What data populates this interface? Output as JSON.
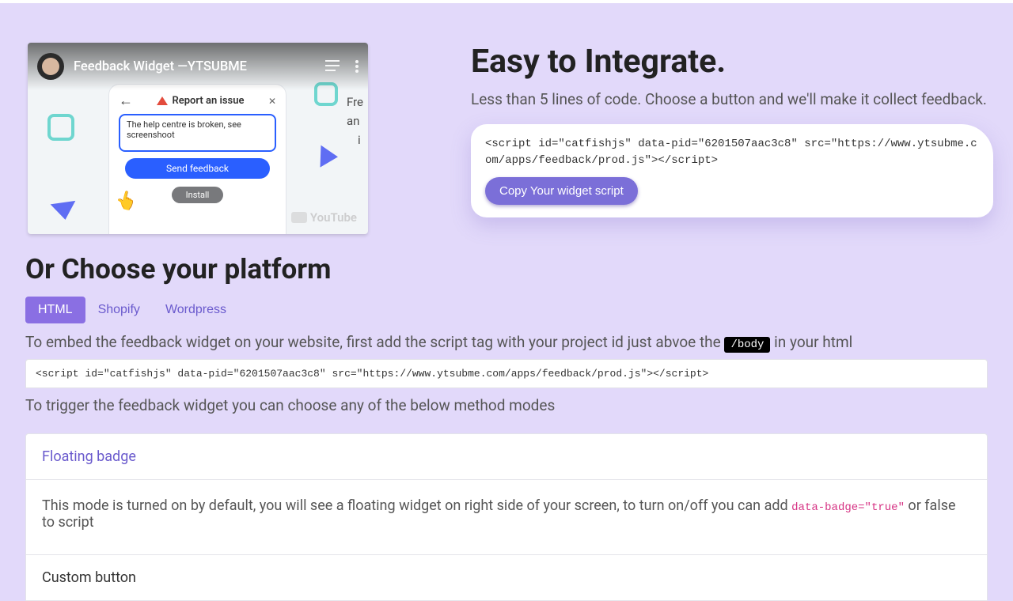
{
  "video": {
    "title": "Feedback Widget —YTSUBME",
    "mock_header": "Report an issue",
    "mock_input": "The help centre is broken, see screenshoot",
    "mock_send": "Send feedback",
    "mock_install": "Install",
    "youtube_label": "YouTube",
    "peek_lines": [
      "Fre",
      "an",
      "i"
    ]
  },
  "hero": {
    "heading": "Easy to Integrate.",
    "sub": "Less than 5 lines of code. Choose a button and we'll make it collect feedback.",
    "code": "<script id=\"catfishjs\" data-pid=\"6201507aac3c8\" src=\"https://www.ytsubme.com/apps/feedback/prod.js\"></script>",
    "copy_label": "Copy Your widget script"
  },
  "platform": {
    "heading": "Or Choose your platform",
    "tabs": [
      "HTML",
      "Shopify",
      "Wordpress"
    ],
    "active_tab": 0,
    "embed_text_before": "To embed the feedback widget on your website, first add the script tag with your project id just abvoe the ",
    "embed_tag": "/body",
    "embed_text_after": " in your html",
    "embed_code": "<script id=\"catfishjs\" data-pid=\"6201507aac3c8\" src=\"https://www.ytsubme.com/apps/feedback/prod.js\"></script>",
    "trigger_text": "To trigger the feedback widget you can choose any of the below method modes"
  },
  "accordion": {
    "floating_title": "Floating badge",
    "floating_body_before": "This mode is turned on by default, you will see a floating widget on right side of your screen, to turn on/off you can add ",
    "floating_code": "data-badge=\"true\"",
    "floating_body_after": " or false to script",
    "custom_title": "Custom button"
  }
}
